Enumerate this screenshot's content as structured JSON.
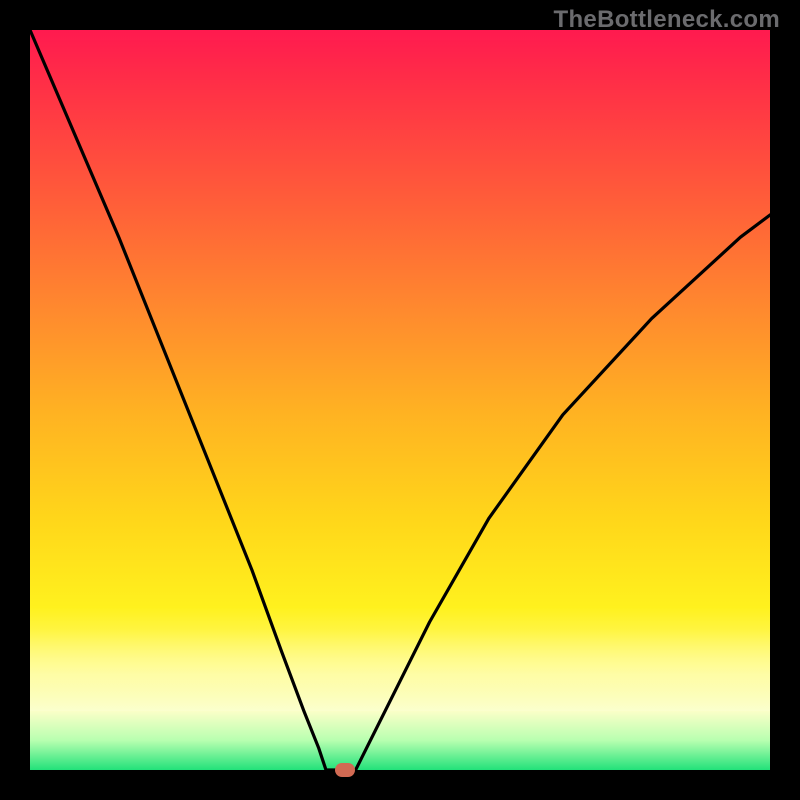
{
  "watermark": {
    "text": "TheBottleneck.com"
  },
  "colors": {
    "bg": "#000000",
    "gradient_top": "#ff1a4f",
    "gradient_mid1": "#ff8a2e",
    "gradient_mid2": "#ffd61a",
    "gradient_low": "#fffb78",
    "gradient_bottom": "#22e27a",
    "curve": "#000000",
    "marker": "#d16a53"
  },
  "chart_data": {
    "type": "line",
    "title": "",
    "xlabel": "",
    "ylabel": "",
    "xlim": [
      0,
      100
    ],
    "ylim": [
      0,
      100
    ],
    "grid": false,
    "series": [
      {
        "name": "bottleneck-curve",
        "x": [
          0,
          6,
          12,
          18,
          24,
          30,
          34,
          37,
          39,
          40,
          41,
          44,
          45,
          48,
          54,
          62,
          72,
          84,
          96,
          100
        ],
        "values": [
          100,
          86,
          72,
          57,
          42,
          27,
          16,
          8,
          3,
          0,
          0,
          0,
          2,
          8,
          20,
          34,
          48,
          61,
          72,
          75
        ]
      }
    ],
    "annotations": [
      {
        "name": "optimal-point-marker",
        "x": 42.5,
        "y": 0
      }
    ],
    "note": "Axis ranges are normalized 0–100; no tick labels are visible in the source image, so values are estimated from curve geometry."
  }
}
